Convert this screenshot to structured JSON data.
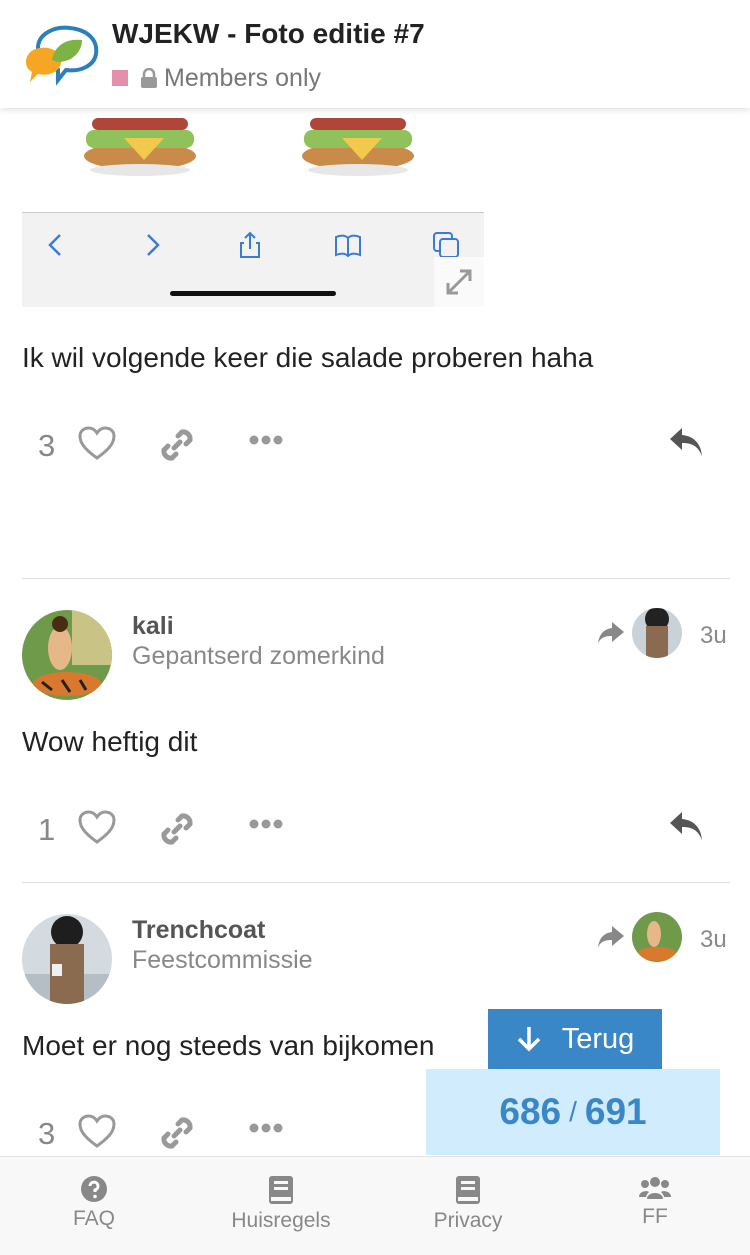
{
  "header": {
    "title": "WJEKW - Foto editie #7",
    "category_color": "#e48fab",
    "category_label": "Members only"
  },
  "posts": [
    {
      "text": "Ik wil volgende keer die salade proberen haha",
      "likes": "3"
    },
    {
      "username": "kali",
      "user_title": "Gepantserd zomerkind",
      "date": "3u",
      "text": "Wow heftig dit",
      "likes": "1"
    },
    {
      "username": "Trenchcoat",
      "user_title": "Feestcommissie",
      "date": "3u",
      "text": "Moet er nog steeds van bijkomen",
      "likes": "3"
    }
  ],
  "timeline": {
    "back_label": "Terug",
    "current": "686",
    "separator": "/",
    "total": "691"
  },
  "footer": {
    "items": [
      {
        "label": "FAQ",
        "icon": "question-circle-icon"
      },
      {
        "label": "Huisregels",
        "icon": "book-icon"
      },
      {
        "label": "Privacy",
        "icon": "book-icon"
      },
      {
        "label": "FF",
        "icon": "users-icon"
      }
    ]
  },
  "colors": {
    "accent": "#3a87c8",
    "progress_bg": "#d1ecfc",
    "muted": "#888888"
  }
}
